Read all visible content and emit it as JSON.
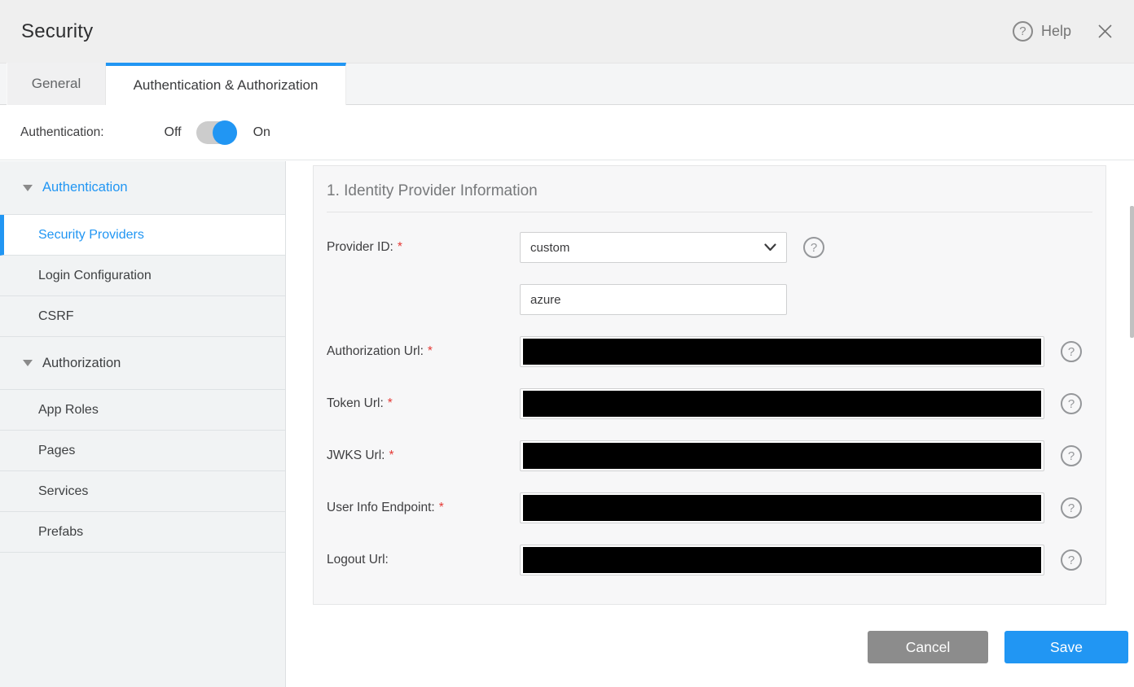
{
  "colors": {
    "accent_blue": "#2196f3",
    "header_bg": "#efefef",
    "sidebar_bg": "#f1f3f4",
    "panel_bg": "#f7f7f8",
    "cancel_gray": "#8c8c8c",
    "required_red": "#e53935",
    "redaction": "#000000"
  },
  "header": {
    "title": "Security",
    "help_label": "Help",
    "help_glyph": "?"
  },
  "tabs": {
    "general": "General",
    "auth": "Authentication & Authorization",
    "active_tab": "Authentication & Authorization"
  },
  "toggle_row": {
    "label": "Authentication:",
    "off": "Off",
    "on": "On",
    "state": "on"
  },
  "sidebar": {
    "authentication_header": "Authentication",
    "authentication_items": [
      "Security Providers",
      "Login Configuration",
      "CSRF"
    ],
    "selected_item": "Security Providers",
    "authorization_header": "Authorization",
    "authorization_items": [
      "App Roles",
      "Pages",
      "Services",
      "Prefabs"
    ]
  },
  "panel": {
    "section_title": "1. Identity Provider Information",
    "required_marker": "*",
    "help_glyph": "?",
    "provider_id": {
      "label": "Provider ID:",
      "required": true,
      "selected_option": "custom",
      "custom_value": "azure"
    },
    "fields": [
      {
        "label": "Authorization Url:",
        "required": true,
        "value_redacted": true
      },
      {
        "label": "Token Url:",
        "required": true,
        "value_redacted": true
      },
      {
        "label": "JWKS Url:",
        "required": true,
        "value_redacted": true
      },
      {
        "label": "User Info Endpoint:",
        "required": true,
        "value_redacted": true
      },
      {
        "label": "Logout Url:",
        "required": false,
        "value_redacted": true
      }
    ]
  },
  "footer": {
    "cancel": "Cancel",
    "save": "Save"
  }
}
